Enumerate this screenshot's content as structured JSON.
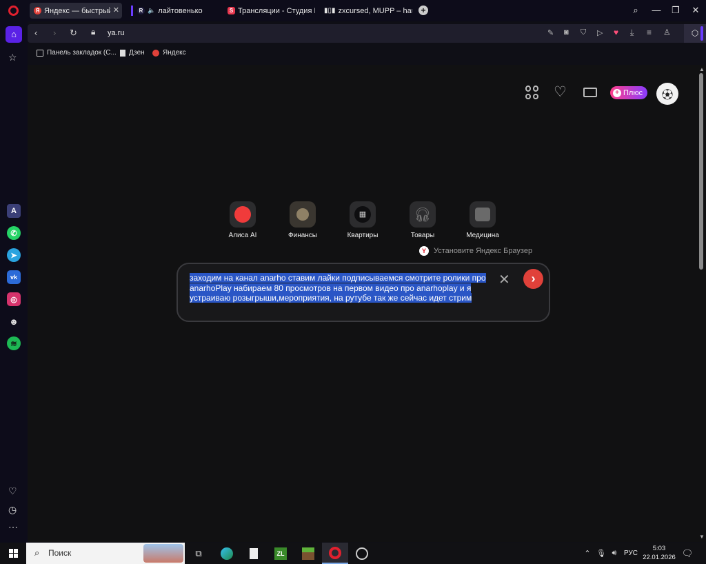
{
  "tabs": [
    {
      "title": "Яндекс — быстрый п",
      "favicon": "Я",
      "favicon_color": "#e0413a",
      "active": true
    },
    {
      "title": "лайтовенько",
      "favicon": "R",
      "favicon_color": "#1c1a3a",
      "active": false
    },
    {
      "title": "Трансляции - Студия RUTUBE",
      "favicon": "S",
      "favicon_color": "#e8384f",
      "active": false
    },
    {
      "title": "zxcursed, MUPP – hau",
      "favicon": "",
      "favicon_color": "#555",
      "active": false
    }
  ],
  "address": {
    "url": "ya.ru"
  },
  "bookmarks": [
    {
      "label": "Панель закладок (С..."
    },
    {
      "label": "Дзен"
    },
    {
      "label": "Яндекс"
    }
  ],
  "header": {
    "plus_label": "Плюс"
  },
  "services": [
    {
      "label": "Алиса AI"
    },
    {
      "label": "Финансы"
    },
    {
      "label": "Квартиры"
    },
    {
      "label": "Товары"
    },
    {
      "label": "Медицина"
    }
  ],
  "install_browser": "Установите Яндекс Браузер",
  "search": {
    "query": "заходим на канал anarho ставим лайки подписываемся смотрите ролики про anarhoPlay набираем 80 просмотров на первом видео про anarhoplay и я устраиваю розыгрыши,мероприятия, на рутубе так же сейчас идет стрим"
  },
  "taskbar": {
    "search_placeholder": "Поиск",
    "lang": "РУС",
    "time": "5:03",
    "date": "22.01.2026"
  },
  "colors": {
    "accent": "#e0413a",
    "selection": "#2a56c6",
    "plus_gradient": "#ff3f8b"
  }
}
